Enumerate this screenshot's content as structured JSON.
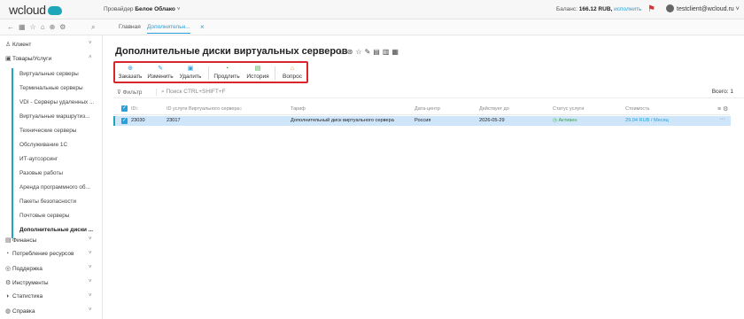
{
  "header": {
    "provider_label": "Провайдер",
    "provider_name": "Белое Облако",
    "balance_label": "Баланс:",
    "balance_value": "166.12 RUB,",
    "topup_label": "исполнить",
    "user_email": "testclient@wcloud.ru"
  },
  "tabs": [
    {
      "label": "Главная"
    },
    {
      "label": "Дополнительн..."
    }
  ],
  "sidebar": {
    "sections_top": [
      {
        "label": "Клиент",
        "chevron": "˅"
      },
      {
        "label": "Товары/Услуги",
        "chevron": "˄"
      }
    ],
    "items": [
      {
        "label": "Виртуальные серверы"
      },
      {
        "label": "Терминальные серверы"
      },
      {
        "label": "VDI - Серверы удаленных ..."
      },
      {
        "label": "Виртуальные маршрутиз..."
      },
      {
        "label": "Технические серверы"
      },
      {
        "label": "Обслуживание 1С"
      },
      {
        "label": "ИТ-аутсорсинг"
      },
      {
        "label": "Разовые работы"
      },
      {
        "label": "Аренда программного об..."
      },
      {
        "label": "Пакеты безопасности"
      },
      {
        "label": "Почтовые серверы"
      },
      {
        "label": "Дополнительные диски ..."
      }
    ],
    "sections_bottom": [
      {
        "label": "Финансы",
        "chevron": "˅"
      },
      {
        "label": "Потребление ресурсов",
        "chevron": "˅"
      },
      {
        "label": "Поддержка",
        "chevron": "˅"
      },
      {
        "label": "Инструменты",
        "chevron": "˅"
      },
      {
        "label": "Статистика",
        "chevron": "˅"
      },
      {
        "label": "Справка",
        "chevron": "˅"
      }
    ]
  },
  "page": {
    "title": "Дополнительные диски виртуальных серверов"
  },
  "toolbar": {
    "order": "Заказать",
    "edit": "Изменить",
    "delete": "Удалить",
    "extend": "Продлить",
    "history": "История",
    "question": "Вопрос"
  },
  "filter": {
    "filter_label": "Фильтр",
    "search_placeholder": "Поиск CTRL+SHIFT+F",
    "total": "Всего: 1"
  },
  "table": {
    "columns": [
      "ID",
      "ID услуги Виртуального сервера",
      "Тариф",
      "Дата-центр",
      "Действует до",
      "Статус услуги",
      "Стоимость"
    ],
    "rows": [
      {
        "id": "23030",
        "vs_id": "23017",
        "tariff": "Дополнительный диск виртуального сервера",
        "dc": "Россия",
        "expires": "2026-05-29",
        "status": "Активен",
        "cost": "29.04 RUB / Месяц"
      }
    ]
  },
  "colors": {
    "accent": "#2a9fd8",
    "brand": "#1fa6b8",
    "highlight": "#d9262c",
    "active": "#3aa845"
  }
}
